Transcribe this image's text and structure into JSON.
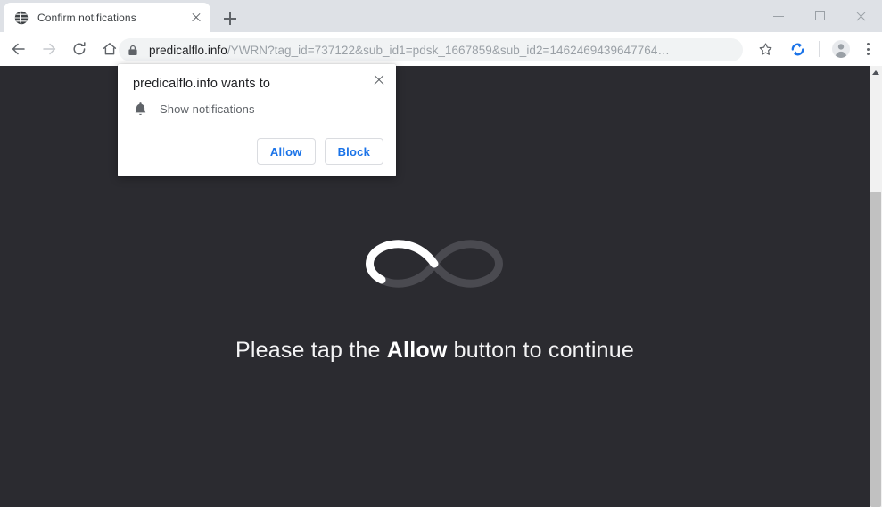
{
  "window": {
    "controls": {
      "minimize": "minimize-window",
      "maximize": "maximize-window",
      "close": "close-window"
    }
  },
  "tabstrip": {
    "tabs": [
      {
        "title": "Confirm notifications",
        "favicon": "globe-icon",
        "close": "close-tab"
      }
    ],
    "new_tab_label": "+"
  },
  "toolbar": {
    "back": "back-icon",
    "forward": "forward-icon",
    "reload": "reload-icon",
    "home": "home-icon",
    "bookmark": "star-icon",
    "extension": "sync-icon",
    "profile": "avatar-icon",
    "menu": "three-dot-menu-icon",
    "omnibox": {
      "security": "lock-icon",
      "host": "predicalflo.info",
      "path": "/YWRN?tag_id=737122&sub_id1=pdsk_1667859&sub_id2=1462469439647764…",
      "full_url": "predicalflo.info/YWRN?tag_id=737122&sub_id1=pdsk_1667859&sub_id2=1462469439647764…"
    }
  },
  "permission_dialog": {
    "title": "predicalflo.info wants to",
    "close": "close-dialog",
    "permission_icon": "bell-icon",
    "permission_label": "Show notifications",
    "allow_label": "Allow",
    "block_label": "Block",
    "accent_color": "#1a73e8"
  },
  "page": {
    "background_color": "#2b2b30",
    "spinner": {
      "name": "infinity-loading-spinner",
      "track_color": "#4a4a50",
      "progress_color": "#ffffff",
      "progress_percent": 45
    },
    "headline_prefix": "Please tap the ",
    "headline_emphasis": "Allow",
    "headline_suffix": " button to continue",
    "text_color": "#f4f4f5"
  },
  "scrollbar": {
    "up_arrow": "scroll-up-arrow-icon",
    "thumb_color": "#c1c1c1",
    "track_color": "#f1f1f1"
  }
}
